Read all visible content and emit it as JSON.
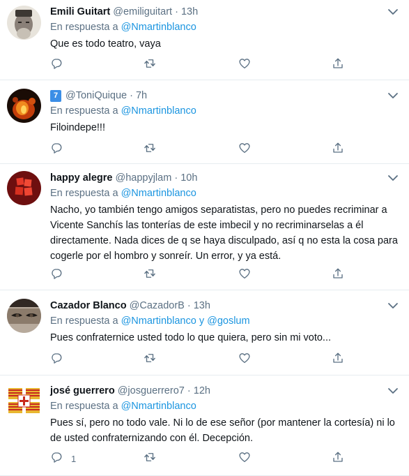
{
  "reply_prefix": "En respuesta a",
  "tweets": [
    {
      "name": "Emili Guitart",
      "handle": "@emiliguitart",
      "time": "13h",
      "reply_to": "@Nmartinblanco",
      "reply_and": "",
      "reply_to2": "",
      "text": "Que es todo teatro, vaya",
      "reply_count": ""
    },
    {
      "name": "",
      "badge": "7",
      "handle": "@ToniQuique",
      "time": "7h",
      "reply_to": "@Nmartinblanco",
      "reply_and": "",
      "reply_to2": "",
      "text": "Filoindepe!!!",
      "reply_count": ""
    },
    {
      "name": "happy alegre",
      "handle": "@happyjlam",
      "time": "10h",
      "reply_to": "@Nmartinblanco",
      "reply_and": "",
      "reply_to2": "",
      "text": "Nacho, yo también tengo amigos separatistas, pero no puedes recriminar a Vicente Sanchís las tonterías de este imbecil y no recriminarselas a él directamente. Nada dices de q se haya disculpado, así q no esta la cosa para cogerle por el hombro y sonreír. Un error, y ya está.",
      "reply_count": ""
    },
    {
      "name": "Cazador Blanco",
      "handle": "@CazadorB",
      "time": "13h",
      "reply_to": "@Nmartinblanco",
      "reply_and": "y",
      "reply_to2": "@goslum",
      "text": "Pues confraternice usted todo lo que quiera, pero sin mi voto...",
      "reply_count": ""
    },
    {
      "name": "josé guerrero",
      "handle": "@josguerrero7",
      "time": "12h",
      "reply_to": "@Nmartinblanco",
      "reply_and": "",
      "reply_to2": "",
      "text": "Pues sí, pero no todo vale. Ni lo de ese señor (por mantener la cortesía) ni lo de usted confraternizando con él. Decepción.",
      "reply_count": "1"
    }
  ],
  "colors": {
    "link": "#1b95e0",
    "muted": "#5b7083",
    "divider": "#e6ecf0"
  },
  "icons": [
    "more-icon",
    "reply-icon",
    "retweet-icon",
    "like-icon",
    "share-icon"
  ]
}
